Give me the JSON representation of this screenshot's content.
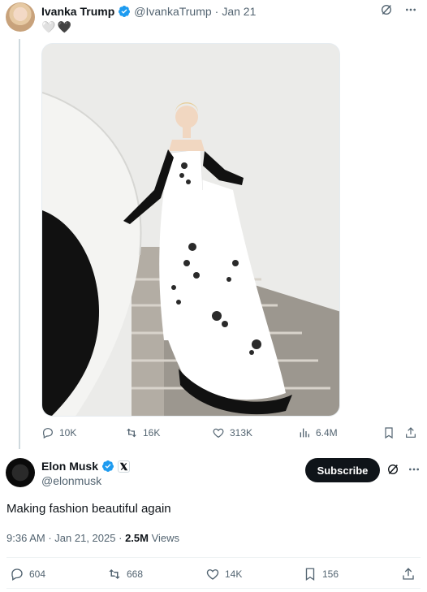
{
  "quoted_tweet": {
    "author_name": "Ivanka Trump",
    "author_handle": "@IvankaTrump",
    "separator": "·",
    "date": "Jan 21",
    "text_emoji": [
      "🤍",
      "🖤"
    ],
    "image_alt": "Photo",
    "stats": {
      "replies": "10K",
      "retweets": "16K",
      "likes": "313K",
      "views": "6.4M"
    }
  },
  "main_tweet": {
    "author_name": "Elon Musk",
    "author_handle": "@elonmusk",
    "subscribe_label": "Subscribe",
    "text": "Making fashion beautiful again",
    "time": "9:36 AM",
    "separator1": "·",
    "date": "Jan 21, 2025",
    "separator2": "·",
    "views_count": "2.5M",
    "views_label": "Views",
    "stats": {
      "replies": "604",
      "retweets": "668",
      "likes": "14K",
      "bookmarks": "156"
    }
  },
  "colors": {
    "verified": "#1d9bf0",
    "text_primary": "#0f1419",
    "text_secondary": "#536471",
    "subscribe_bg": "#0f1419"
  }
}
